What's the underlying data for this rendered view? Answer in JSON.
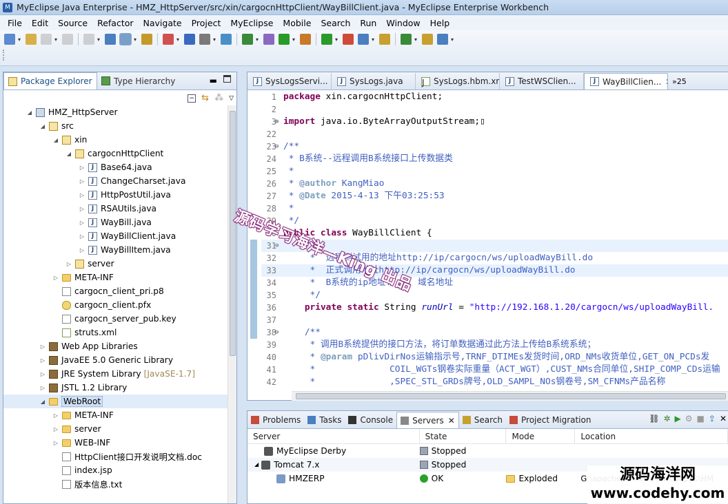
{
  "window": {
    "title": "MyEclipse Java Enterprise - HMZ_HttpServer/src/xin/cargocnHttpClient/WayBillClient.java - MyEclipse Enterprise Workbench"
  },
  "menu": [
    "File",
    "Edit",
    "Source",
    "Refactor",
    "Navigate",
    "Project",
    "MyEclipse",
    "Mobile",
    "Search",
    "Run",
    "Window",
    "Help"
  ],
  "explorer": {
    "tabs": [
      {
        "label": "Package Explorer",
        "active": true
      },
      {
        "label": "Type Hierarchy",
        "active": false
      }
    ],
    "tree": [
      {
        "label": "HMZ_HttpServer",
        "depth": 1,
        "icon": "project",
        "expanded": true
      },
      {
        "label": "src",
        "depth": 2,
        "icon": "src",
        "expanded": true
      },
      {
        "label": "xin",
        "depth": 3,
        "icon": "package",
        "expanded": true
      },
      {
        "label": "cargocnHttpClient",
        "depth": 4,
        "icon": "package",
        "expanded": true
      },
      {
        "label": "Base64.java",
        "depth": 5,
        "icon": "java",
        "expanded": false
      },
      {
        "label": "ChangeCharset.java",
        "depth": 5,
        "icon": "java",
        "expanded": false
      },
      {
        "label": "HttpPostUtil.java",
        "depth": 5,
        "icon": "java",
        "expanded": false
      },
      {
        "label": "RSAUtils.java",
        "depth": 5,
        "icon": "java",
        "expanded": false
      },
      {
        "label": "WayBill.java",
        "depth": 5,
        "icon": "java",
        "expanded": false
      },
      {
        "label": "WayBillClient.java",
        "depth": 5,
        "icon": "java",
        "expanded": false
      },
      {
        "label": "WayBillItem.java",
        "depth": 5,
        "icon": "java",
        "expanded": false
      },
      {
        "label": "server",
        "depth": 4,
        "icon": "package",
        "expanded": false
      },
      {
        "label": "META-INF",
        "depth": 3,
        "icon": "folder",
        "expanded": false
      },
      {
        "label": "cargocn_client_pri.p8",
        "depth": 3,
        "icon": "file",
        "leaf": true
      },
      {
        "label": "cargocn_client.pfx",
        "depth": 3,
        "icon": "key",
        "leaf": true
      },
      {
        "label": "cargocn_server_pub.key",
        "depth": 3,
        "icon": "file",
        "leaf": true
      },
      {
        "label": "struts.xml",
        "depth": 3,
        "icon": "xml",
        "leaf": true
      },
      {
        "label": "Web App Libraries",
        "depth": 2,
        "icon": "lib",
        "expanded": false
      },
      {
        "label": "JavaEE 5.0 Generic Library",
        "depth": 2,
        "icon": "lib",
        "expanded": false
      },
      {
        "label": "JRE System Library",
        "depth": 2,
        "icon": "lib",
        "expanded": false,
        "decoration": "[JavaSE-1.7]"
      },
      {
        "label": "JSTL 1.2 Library",
        "depth": 2,
        "icon": "lib",
        "expanded": false
      },
      {
        "label": "WebRoot",
        "depth": 2,
        "icon": "folder-open",
        "expanded": true,
        "selected": true
      },
      {
        "label": "META-INF",
        "depth": 3,
        "icon": "folder",
        "expanded": false
      },
      {
        "label": "server",
        "depth": 3,
        "icon": "folder",
        "expanded": false
      },
      {
        "label": "WEB-INF",
        "depth": 3,
        "icon": "folder",
        "expanded": false
      },
      {
        "label": "HttpClient接口开发说明文档.doc",
        "depth": 3,
        "icon": "file",
        "leaf": true
      },
      {
        "label": "index.jsp",
        "depth": 3,
        "icon": "file",
        "leaf": true
      },
      {
        "label": "版本信息.txt",
        "depth": 3,
        "icon": "file",
        "leaf": true
      }
    ]
  },
  "editor": {
    "tabs": [
      {
        "label": "SysLogsServi...",
        "active": false
      },
      {
        "label": "SysLogs.java",
        "active": false
      },
      {
        "label": "SysLogs.hbm.xml",
        "active": false
      },
      {
        "label": "TestWSClien...",
        "active": false
      },
      {
        "label": "WayBillClien...",
        "active": true
      }
    ],
    "overflow": "»25"
  },
  "code": [
    {
      "n": "1",
      "t": [
        [
          "kw",
          "package"
        ],
        [
          "",
          "xin.cargocnHttpClient;"
        ]
      ]
    },
    {
      "n": "2",
      "t": []
    },
    {
      "n": "3",
      "f": "+",
      "t": [
        [
          "kw",
          "import"
        ],
        [
          "",
          "java.io.ByteArrayOutputStream;▯"
        ]
      ]
    },
    {
      "n": "22",
      "t": []
    },
    {
      "n": "23",
      "f": "-",
      "t": [
        [
          "cm",
          "/**"
        ]
      ]
    },
    {
      "n": "24",
      "t": [
        [
          "cm",
          " * B系统--远程调用B系统接口上传数据类"
        ]
      ]
    },
    {
      "n": "25",
      "t": [
        [
          "cm",
          " * "
        ]
      ]
    },
    {
      "n": "26",
      "t": [
        [
          "cm",
          " * "
        ],
        [
          "tag",
          "@author"
        ],
        [
          "cm",
          " KangMiao"
        ]
      ]
    },
    {
      "n": "27",
      "t": [
        [
          "cm",
          " * "
        ],
        [
          "tag",
          "@Date"
        ],
        [
          "cm",
          " 2015-4-13 下午03:25:53"
        ]
      ]
    },
    {
      "n": "28",
      "t": [
        [
          "cm",
          " * "
        ]
      ]
    },
    {
      "n": "29",
      "t": [
        [
          "cm",
          " */"
        ]
      ]
    },
    {
      "n": "30",
      "t": [
        [
          "kw",
          "public class"
        ],
        [
          "",
          " WayBillClient {"
        ]
      ]
    },
    {
      "n": "31",
      "f": "-",
      "hl": true,
      "t": [
        [
          "cm",
          "    /**"
        ]
      ]
    },
    {
      "n": "32",
      "t": [
        [
          "cm",
          "     *  远程测试用的地址http://ip/cargocn/ws/uploadWayBill.do"
        ]
      ]
    },
    {
      "n": "33",
      "hl": true,
      "t": [
        [
          "cm",
          "     *  正式调用地址http://ip/cargocn/ws/uploadWayBill.do"
        ]
      ]
    },
    {
      "n": "34",
      "t": [
        [
          "cm",
          "     *  B系统的ip地址: ..; 域名地址"
        ]
      ]
    },
    {
      "n": "35",
      "t": [
        [
          "cm",
          "     */"
        ]
      ]
    },
    {
      "n": "36",
      "t": [
        [
          "",
          "    "
        ],
        [
          "kw",
          "private static"
        ],
        [
          "",
          " String "
        ],
        [
          "fld",
          "runUrl"
        ],
        [
          "",
          " = "
        ],
        [
          "str",
          "\"http://192.168.1.20/cargocn/ws/uploadWayBill."
        ]
      ]
    },
    {
      "n": "37",
      "t": []
    },
    {
      "n": "38",
      "f": "-",
      "t": [
        [
          "cm",
          "    /**"
        ]
      ]
    },
    {
      "n": "39",
      "t": [
        [
          "cm",
          "     * 调用B系统提供的接口方法，将订单数据通过此方法上传给B系统系统；"
        ]
      ]
    },
    {
      "n": "40",
      "t": [
        [
          "cm",
          "     * "
        ],
        [
          "tag",
          "@param"
        ],
        [
          "cm",
          " pDlivDirNos运输指示号,TRNF_DTIMEs发货时间,ORD_NMs收货单位,GET_ON_PCDs发"
        ]
      ]
    },
    {
      "n": "41",
      "t": [
        [
          "cm",
          "     *              COIL_WGTs钢卷实际重量（ACT_WGT）,CUST_NMs合同单位,SHIP_COMP_CDs运输"
        ]
      ]
    },
    {
      "n": "42",
      "t": [
        [
          "cm",
          "     *              ,SPEC_STL_GRDs牌号,OLD_SAMPL_NOs钢卷号,SM_CFNMs产品名称"
        ]
      ]
    }
  ],
  "servers_view": {
    "tabs": [
      {
        "label": "Problems",
        "active": false
      },
      {
        "label": "Tasks",
        "active": false
      },
      {
        "label": "Console",
        "active": false
      },
      {
        "label": "Servers",
        "active": true
      },
      {
        "label": "Search",
        "active": false
      },
      {
        "label": "Project Migration",
        "active": false
      }
    ],
    "columns": [
      "Server",
      "State",
      "Mode",
      "Location"
    ],
    "rows": [
      {
        "server": "MyEclipse Derby",
        "state": "Stopped",
        "mode": "",
        "location": "",
        "depth": 1
      },
      {
        "server": "Tomcat  7.x",
        "state": "Stopped",
        "mode": "",
        "location": "",
        "depth": 1,
        "expanded": true
      },
      {
        "server": "HMZERP",
        "state": "OK",
        "mode": "Exploded",
        "location": "G:\\apache-tomcat-7\\webapps\\HM",
        "depth": 2
      }
    ]
  },
  "watermarks": {
    "diagonal": "源码学习海洋—King 出品",
    "corner_line1": "源码海洋网",
    "corner_line2": "www.codehy.com"
  },
  "colors": {
    "keyword": "#7f0055",
    "comment": "#3f5fbf",
    "string": "#2a00ff",
    "javadoc_tag": "#7f9fbf"
  }
}
